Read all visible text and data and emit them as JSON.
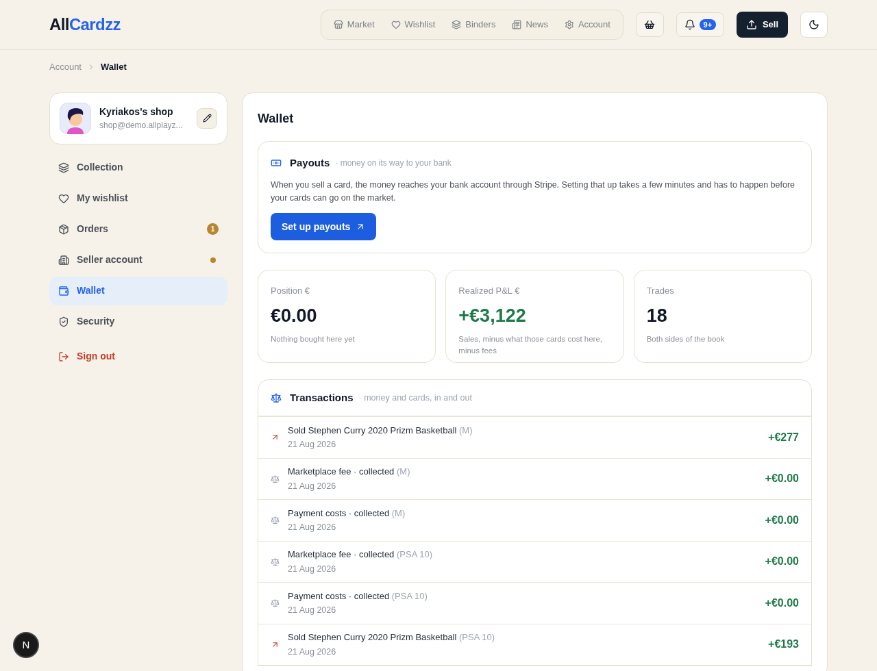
{
  "logo": {
    "part_1": "All",
    "part_2": "Cardzz"
  },
  "nav": [
    {
      "label": "Market"
    },
    {
      "label": "Wishlist"
    },
    {
      "label": "Binders"
    },
    {
      "label": "News"
    },
    {
      "label": "Account"
    }
  ],
  "notifications_badge": "9+",
  "sell_button": "Sell",
  "breadcrumb": [
    {
      "label": "Account",
      "current": false
    },
    {
      "label": "Wallet",
      "current": true
    }
  ],
  "profile": {
    "name": "Kyriakos's shop",
    "email": "shop@demo.allplayz..."
  },
  "sidebar": [
    {
      "label": "Collection",
      "selected": false,
      "kind": "normal"
    },
    {
      "label": "My wishlist",
      "selected": false,
      "kind": "normal"
    },
    {
      "label": "Orders",
      "selected": false,
      "kind": "normal",
      "badge": "1"
    },
    {
      "label": "Seller account",
      "selected": false,
      "kind": "normal",
      "dot": true
    },
    {
      "label": "Wallet",
      "selected": true,
      "kind": "normal"
    },
    {
      "label": "Security",
      "selected": false,
      "kind": "normal"
    },
    {
      "label": "Sign out",
      "selected": false,
      "kind": "danger"
    }
  ],
  "page_title": "Wallet",
  "payouts": {
    "title": "Payouts",
    "subtitle": "· money on its way to your bank",
    "text": "When you sell a card, the money reaches your bank account through Stripe. Setting that up takes a few minutes and has to happen before your cards can go on the market.",
    "button": "Set up payouts"
  },
  "stats": [
    {
      "label": "Position €",
      "value": "€0.00",
      "note": "Nothing bought here yet",
      "positive": false
    },
    {
      "label": "Realized P&L €",
      "value": "+€3,122",
      "note": "Sales, minus what those cards cost here, minus fees",
      "positive": true
    },
    {
      "label": "Trades",
      "value": "18",
      "note": "Both sides of the book",
      "positive": false
    }
  ],
  "transactions": {
    "title": "Transactions",
    "subtitle": "· money and cards, in and out",
    "rows": [
      {
        "kind": "sale",
        "title": "Sold Stephen Curry 2020 Prizm Basketball",
        "grade": "(M)",
        "date": "21 Aug 2026",
        "amount": "+€277"
      },
      {
        "kind": "fee",
        "title": "Marketplace fee · collected",
        "grade": "(M)",
        "date": "21 Aug 2026",
        "amount": "+€0.00"
      },
      {
        "kind": "fee",
        "title": "Payment costs · collected",
        "grade": "(M)",
        "date": "21 Aug 2026",
        "amount": "+€0.00"
      },
      {
        "kind": "fee",
        "title": "Marketplace fee · collected",
        "grade": "(PSA 10)",
        "date": "21 Aug 2026",
        "amount": "+€0.00"
      },
      {
        "kind": "fee",
        "title": "Payment costs · collected",
        "grade": "(PSA 10)",
        "date": "21 Aug 2026",
        "amount": "+€0.00"
      },
      {
        "kind": "sale",
        "title": "Sold Stephen Curry 2020 Prizm Basketball",
        "grade": "(PSA 10)",
        "date": "21 Aug 2026",
        "amount": "+€193"
      }
    ]
  },
  "dev_badge": "N"
}
